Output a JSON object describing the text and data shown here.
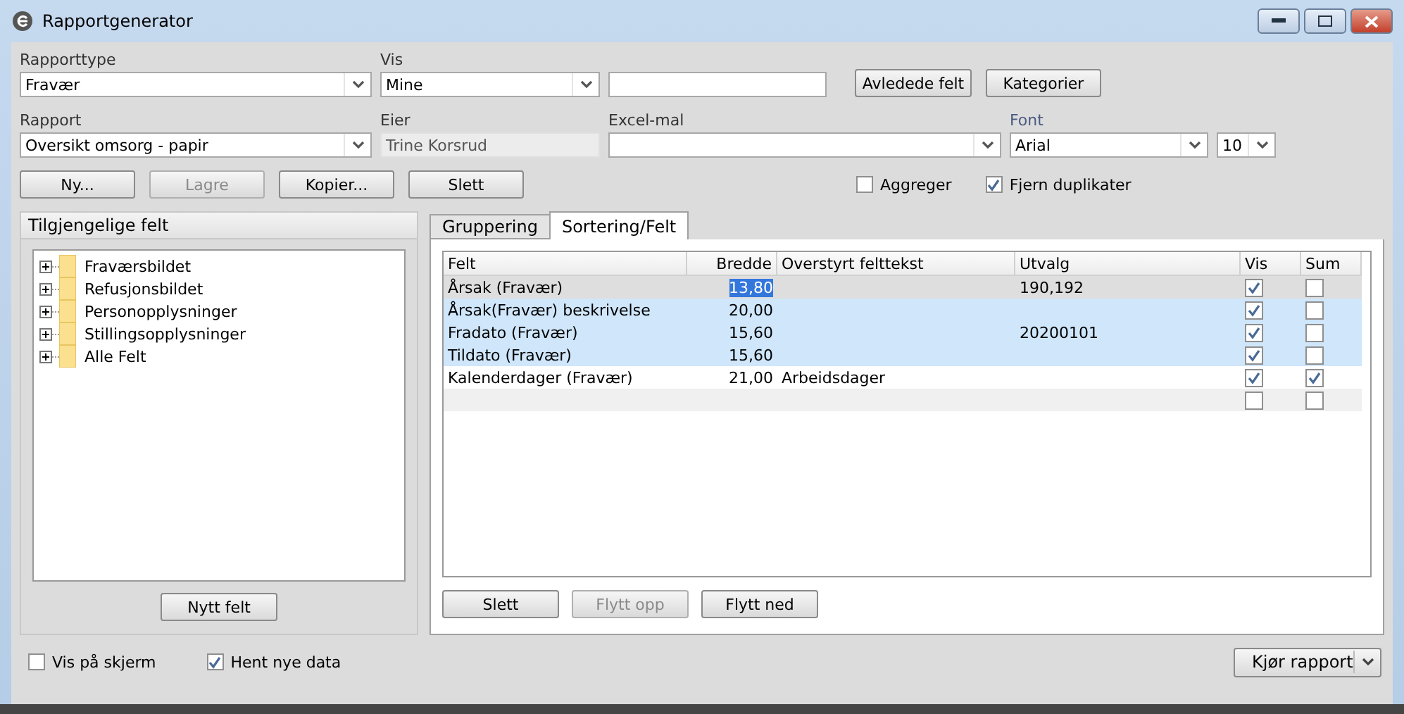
{
  "window": {
    "title": "Rapportgenerator"
  },
  "fields_row1": [
    {
      "kind": "select",
      "label": "Rapporttype",
      "value": "Fravær"
    },
    {
      "kind": "select",
      "label": "Vis",
      "value": "Mine"
    },
    {
      "kind": "text"
    }
  ],
  "top_buttons": [
    {
      "label": "Avledede felt",
      "disabled": false
    },
    {
      "label": "Kategorier",
      "disabled": false
    }
  ],
  "fields_row2": [
    {
      "kind": "select",
      "label": "Rapport",
      "value": "Oversikt omsorg - papir"
    },
    {
      "kind": "readonly",
      "label": "Eier",
      "value": "Trine Korsrud"
    },
    {
      "kind": "select",
      "label": "Excel-mal"
    },
    {
      "kind": "select",
      "label": "Font",
      "value": "Arial"
    },
    {
      "kind": "select",
      "value": "10"
    }
  ],
  "action_buttons": [
    {
      "label": "Ny...",
      "disabled": false
    },
    {
      "label": "Lagre",
      "disabled": true
    },
    {
      "label": "Kopier...",
      "disabled": false
    },
    {
      "label": "Slett",
      "disabled": false
    }
  ],
  "options": [
    {
      "label": "Aggreger",
      "checked": false
    },
    {
      "label": "Fjern duplikater",
      "checked": true
    }
  ],
  "available_fields": {
    "title": "Tilgjengelige felt",
    "items": [
      {
        "label": "Fraværsbildet",
        "expanded": false
      },
      {
        "label": "Refusjonsbildet",
        "expanded": false
      },
      {
        "label": "Personopplysninger",
        "expanded": false
      },
      {
        "label": "Stillingsopplysninger",
        "expanded": false
      },
      {
        "label": "Alle Felt",
        "expanded": false
      }
    ],
    "button": "Nytt felt"
  },
  "tabs": [
    {
      "label": "Gruppering",
      "selected": false
    },
    {
      "label": "Sortering/Felt",
      "selected": true
    }
  ],
  "table": {
    "columns": [
      "Felt",
      "Bredde",
      "Overstyrt felttekst",
      "Utvalg",
      "Vis",
      "Sum"
    ],
    "rows": [
      {
        "felt": "Årsak (Fravær)",
        "bredde": "13,80",
        "overstyrt": "",
        "utvalg": "190,192",
        "vis": true,
        "sum": false,
        "selected": true,
        "current": true
      },
      {
        "felt": "Årsak(Fravær) beskrivelse",
        "bredde": "20,00",
        "overstyrt": "",
        "utvalg": "",
        "vis": true,
        "sum": false,
        "selected": true,
        "current": false
      },
      {
        "felt": "Fradato (Fravær)",
        "bredde": "15,60",
        "overstyrt": "",
        "utvalg": "20200101",
        "vis": true,
        "sum": false,
        "selected": true,
        "current": false
      },
      {
        "felt": "Tildato (Fravær)",
        "bredde": "15,60",
        "overstyrt": "",
        "utvalg": "",
        "vis": true,
        "sum": false,
        "selected": true,
        "current": false
      },
      {
        "felt": "Kalenderdager (Fravær)",
        "bredde": "21,00",
        "overstyrt": "Arbeidsdager",
        "utvalg": "",
        "vis": true,
        "sum": true,
        "selected": false,
        "current": false
      }
    ],
    "new_row": {
      "vis": false,
      "sum": false
    }
  },
  "table_buttons": [
    {
      "label": "Slett",
      "disabled": false
    },
    {
      "label": "Flytt opp",
      "disabled": true
    },
    {
      "label": "Flytt ned",
      "disabled": false
    }
  ],
  "footer_options": [
    {
      "label": "Vis på skjerm",
      "checked": false
    },
    {
      "label": "Hent nye data",
      "checked": true
    }
  ],
  "run_button": "Kjør rapport"
}
